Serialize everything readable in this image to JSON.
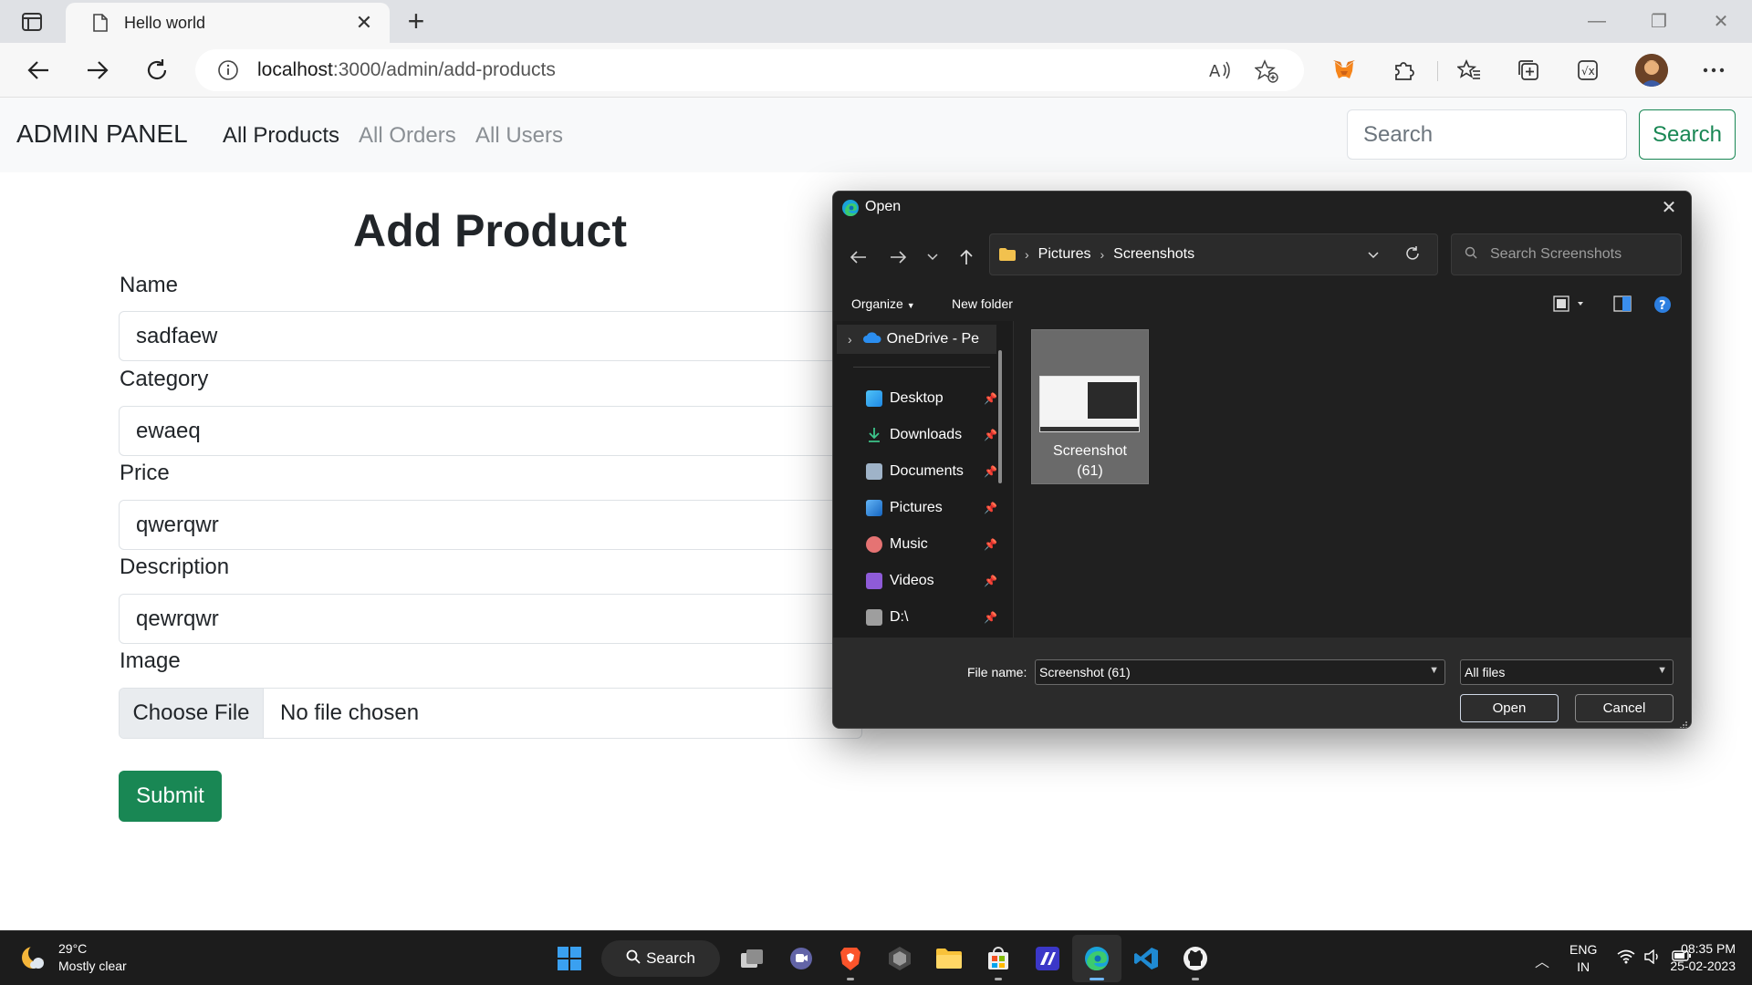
{
  "browser": {
    "tab_title": "Hello world",
    "url_host": "localhost",
    "url_rest": ":3000/admin/add-products"
  },
  "page": {
    "brand": "ADMIN PANEL",
    "nav_links": [
      "All Products",
      "All Orders",
      "All Users"
    ],
    "search_placeholder": "Search",
    "search_button": "Search",
    "form_title": "Add Product",
    "fields": [
      {
        "label": "Name",
        "value": "sadfaew"
      },
      {
        "label": "Category",
        "value": "ewaeq"
      },
      {
        "label": "Price",
        "value": "qwerqwr"
      },
      {
        "label": "Description",
        "value": "qewrqwr"
      }
    ],
    "image_label": "Image",
    "choose_file": "Choose File",
    "file_status": "No file chosen",
    "submit": "Submit",
    "accent_color": "#198754"
  },
  "dialog": {
    "title": "Open",
    "breadcrumb": [
      "Pictures",
      "Screenshots"
    ],
    "search_placeholder": "Search Screenshots",
    "organize": "Organize",
    "new_folder": "New folder",
    "onedrive": "OneDrive - Pe",
    "nav_items": [
      {
        "label": "Desktop",
        "icon": "desktop-icon"
      },
      {
        "label": "Downloads",
        "icon": "downloads-icon"
      },
      {
        "label": "Documents",
        "icon": "documents-icon"
      },
      {
        "label": "Pictures",
        "icon": "pictures-icon"
      },
      {
        "label": "Music",
        "icon": "music-icon"
      },
      {
        "label": "Videos",
        "icon": "videos-icon"
      },
      {
        "label": "D:\\",
        "icon": "drive-icon"
      }
    ],
    "file": {
      "name_line1": "Screenshot",
      "name_line2": "(61)"
    },
    "file_name_label": "File name:",
    "file_name_value": "Screenshot (61)",
    "file_type": "All files",
    "open_button": "Open",
    "cancel_button": "Cancel"
  },
  "taskbar": {
    "temperature": "29°C",
    "weather": "Mostly clear",
    "search": "Search",
    "lang_1": "ENG",
    "lang_2": "IN",
    "time": "08:35 PM",
    "date": "25-02-2023"
  }
}
